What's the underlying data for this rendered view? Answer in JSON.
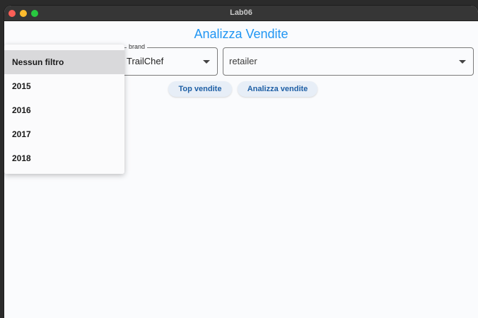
{
  "window": {
    "title": "Lab06"
  },
  "app": {
    "title": "Analizza Vendite"
  },
  "filters": {
    "brand": {
      "legend": "brand",
      "value": "TrailChef"
    },
    "retailer": {
      "value": "retailer"
    }
  },
  "buttons": {
    "top": "Top vendite",
    "analizza": "Analizza vendite"
  },
  "year_dropdown": {
    "options": [
      "Nessun filtro",
      "2015",
      "2016",
      "2017",
      "2018"
    ],
    "selected": "Nessun filtro"
  },
  "colors": {
    "accent": "#2196f3",
    "button_bg": "#e7eef7",
    "selected_option_bg": "#d9d9db"
  }
}
